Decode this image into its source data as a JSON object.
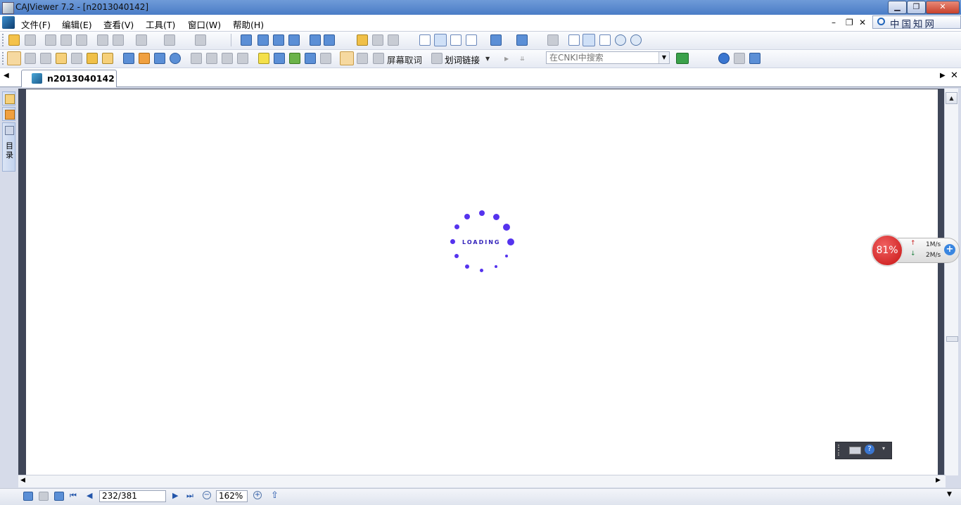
{
  "window": {
    "title": "CAJViewer 7.2 - [n2013040142]",
    "controls": {
      "minimize": "▁",
      "restore": "❐",
      "close": "✕"
    },
    "mdi_controls": {
      "minimize": "–",
      "restore": "❐",
      "close": "✕"
    }
  },
  "menu": {
    "items": [
      "文件(F)",
      "编辑(E)",
      "查看(V)",
      "工具(T)",
      "窗口(W)",
      "帮助(H)"
    ]
  },
  "brand": {
    "label": "中国知网"
  },
  "toolbar2": {
    "screen_word_label": "屏幕取词",
    "word_link_label": "划词链接",
    "search_placeholder": "在CNKI中搜索"
  },
  "tab": {
    "label": "n2013040142"
  },
  "side_panel": {
    "toc_label": "目录"
  },
  "loading": {
    "text": "LOADING"
  },
  "network": {
    "percent": "81%",
    "upload": "1M/s",
    "download": "2M/s"
  },
  "statusbar": {
    "page": "232/381",
    "zoom": "162%"
  },
  "colors": {
    "titlebar": "#4a7cc6",
    "spinner": "#5533ee",
    "badge": "#c81414"
  }
}
